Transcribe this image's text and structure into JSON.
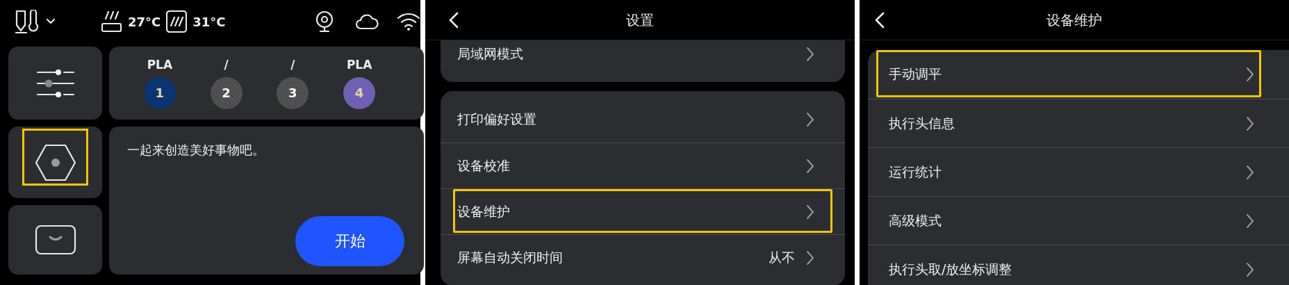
{
  "home": {
    "status_bar": {
      "bed_temp": "27°C",
      "chamber_temp": "31°C"
    },
    "sidebar": [
      {
        "kind": "sliders",
        "highlighted": false
      },
      {
        "kind": "hexagon",
        "highlighted": true
      },
      {
        "kind": "tray",
        "highlighted": false
      }
    ],
    "filament_slots": [
      {
        "material": "PLA",
        "number": "1",
        "empty": false,
        "color": "#0b3473"
      },
      {
        "material": "/",
        "number": "2",
        "empty": true
      },
      {
        "material": "/",
        "number": "3",
        "empty": true
      },
      {
        "material": "PLA",
        "number": "4",
        "empty": false,
        "color": "#7060b4"
      }
    ],
    "message": "一起来创造美好事物吧。",
    "start_button": "开始"
  },
  "settings": {
    "title": "设置",
    "groups": [
      [
        {
          "label": "局域网模式",
          "highlighted": false
        }
      ],
      [
        {
          "label": "打印偏好设置",
          "highlighted": false
        },
        {
          "label": "设备校准",
          "highlighted": false
        },
        {
          "label": "设备维护",
          "highlighted": true
        },
        {
          "label": "屏幕自动关闭时间",
          "value": "从不",
          "highlighted": false
        }
      ]
    ]
  },
  "maintenance": {
    "title": "设备维护",
    "groups": [
      [
        {
          "label": "手动调平",
          "highlighted": true
        },
        {
          "label": "执行头信息",
          "highlighted": false
        },
        {
          "label": "运行统计",
          "highlighted": false
        },
        {
          "label": "高级模式",
          "highlighted": false
        },
        {
          "label": "执行头取/放坐标调整",
          "highlighted": false
        }
      ]
    ]
  }
}
